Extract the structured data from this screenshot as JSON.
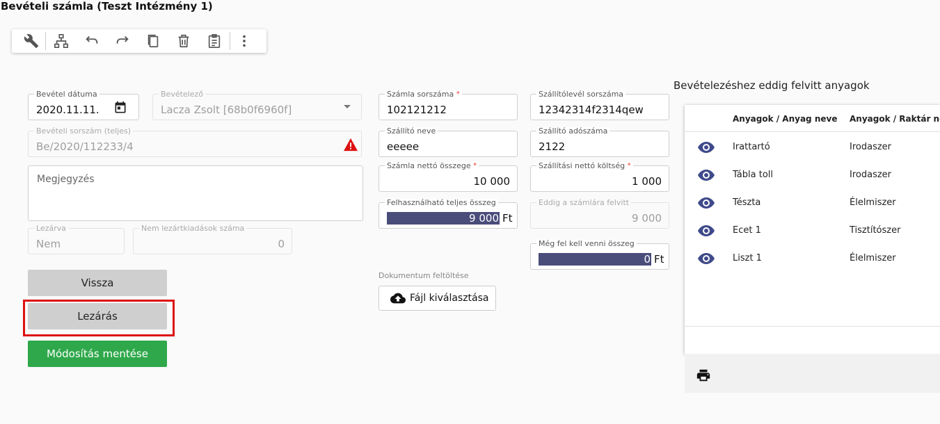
{
  "page_title": "Bevételi számla (Teszt Intézmény 1)",
  "toolbar": {
    "icons": [
      "wrench-icon",
      "hierarchy-icon",
      "undo-icon",
      "redo-icon",
      "copy-icon",
      "delete-icon",
      "clipboard-icon",
      "more-vert-icon"
    ]
  },
  "form": {
    "bevetel_datuma": {
      "label": "Bevétel dátuma",
      "value": "2020.11.11."
    },
    "bevetelezo": {
      "label": "Bevételező",
      "value": "Lacza Zsolt [68b0f6960f]"
    },
    "beveteli_sorszam": {
      "label": "Bevételi sorszám (teljes)",
      "value": "Be/2020/112233/4"
    },
    "megjegyzes": {
      "placeholder": "Megjegyzés"
    },
    "lezarva": {
      "label": "Lezárva",
      "value": "Nem"
    },
    "nem_lezart": {
      "label": "Nem lezártkiadások száma",
      "value": "0"
    },
    "szamla_sorszama": {
      "label": "Számla sorszáma",
      "value": "102121212"
    },
    "szallitolevel_sorszama": {
      "label": "Szállítólevél sorszáma",
      "value": "12342314f2314qew"
    },
    "szallito_neve": {
      "label": "Szállító neve",
      "value": "eeeee"
    },
    "szallito_adoszama": {
      "label": "Szállító adószáma",
      "value": "2122"
    },
    "szamla_netto": {
      "label": "Számla nettó összege",
      "value": "10 000"
    },
    "szallitasi_netto": {
      "label": "Szállítási nettó költség",
      "value": "1 000"
    },
    "felhasznalhato": {
      "label": "Felhasználható teljes összeg",
      "value": "9 000",
      "unit": "Ft"
    },
    "eddig_felvitt": {
      "label": "Eddig a számlára felvitt",
      "value": "9 000"
    },
    "meg_fel_kell": {
      "label": "Még fel kell venni összeg",
      "value": "0",
      "unit": "Ft"
    }
  },
  "buttons": {
    "vissza": "Vissza",
    "lezaras": "Lezárás",
    "mentes": "Módosítás mentése"
  },
  "upload": {
    "label": "Dokumentum feltöltése",
    "button": "Fájl kiválasztása"
  },
  "materials": {
    "title": "Bevételezéshez eddig felvitt anyagok",
    "columns": [
      "Anyagok / Anyag neve",
      "Anyagok / Raktár neve"
    ],
    "rows": [
      {
        "name": "Irattartó",
        "warehouse": "Irodaszer"
      },
      {
        "name": "Tábla toll",
        "warehouse": "Irodaszer"
      },
      {
        "name": "Tészta",
        "warehouse": "Élelmiszer"
      },
      {
        "name": "Ecet 1",
        "warehouse": "Tisztítószer"
      },
      {
        "name": "Liszt 1",
        "warehouse": "Élelmiszer"
      }
    ]
  },
  "colors": {
    "accent_bar": "#4a4c7a",
    "save_green": "#2ea84a",
    "eye_blue": "#3f4a8a",
    "highlight_red": "#dd1111"
  }
}
